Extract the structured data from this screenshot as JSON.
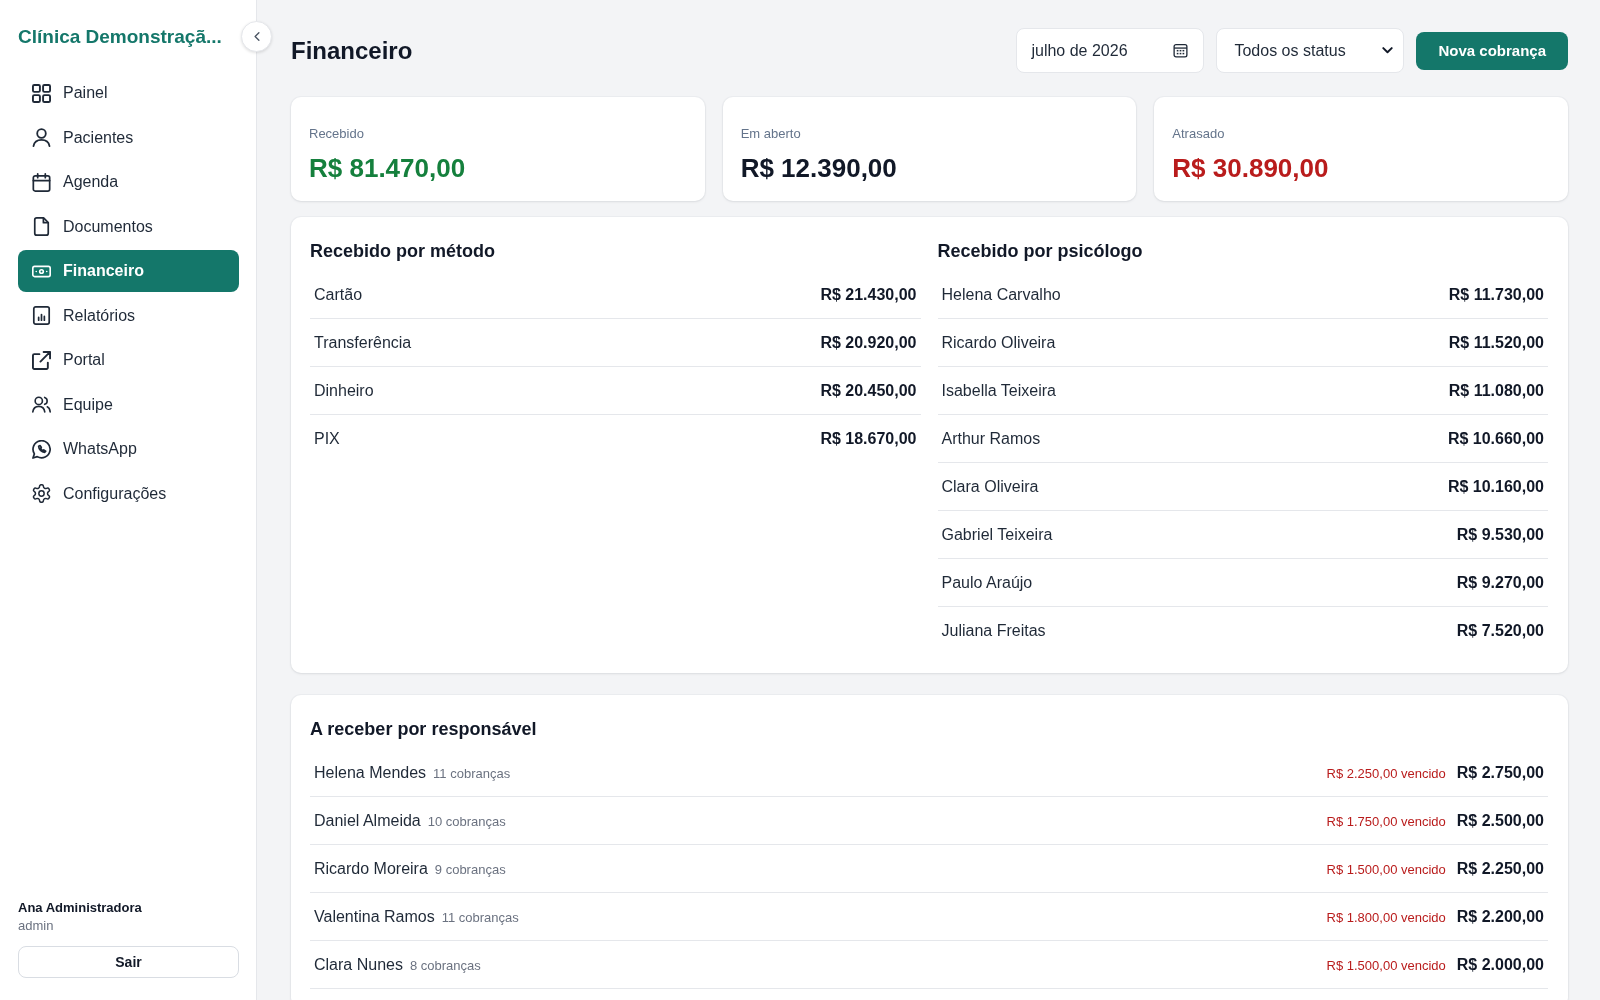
{
  "sidebar": {
    "title": "Clínica Demonstraçã...",
    "items": [
      {
        "label": "Painel",
        "selected": false
      },
      {
        "label": "Pacientes",
        "selected": false
      },
      {
        "label": "Agenda",
        "selected": false
      },
      {
        "label": "Documentos",
        "selected": false
      },
      {
        "label": "Financeiro",
        "selected": true
      },
      {
        "label": "Relatórios",
        "selected": false
      },
      {
        "label": "Portal",
        "selected": false
      },
      {
        "label": "Equipe",
        "selected": false
      },
      {
        "label": "WhatsApp",
        "selected": false
      },
      {
        "label": "Configurações",
        "selected": false
      }
    ],
    "user": {
      "name": "Ana Administradora",
      "role": "admin"
    },
    "logout_button": "Sair"
  },
  "header": {
    "title": "Financeiro",
    "month_field": {
      "value": "julho de 2026"
    },
    "status_select": {
      "value": "Todos os status"
    },
    "new_button": "Nova cobrança"
  },
  "summary_cards": [
    {
      "label": "Recebido",
      "value": "R$ 81.470,00",
      "color": "#15803d"
    },
    {
      "label": "Em aberto",
      "value": "R$ 12.390,00",
      "color": "#111827"
    },
    {
      "label": "Atrasado",
      "value": "R$ 30.890,00",
      "color": "#b91c1c"
    }
  ],
  "breakdowns": [
    {
      "title": "Recebido por método",
      "rows": [
        {
          "label": "Cartão",
          "amount": "R$ 21.430,00"
        },
        {
          "label": "Transferência",
          "amount": "R$ 20.920,00"
        },
        {
          "label": "Dinheiro",
          "amount": "R$ 20.450,00"
        },
        {
          "label": "PIX",
          "amount": "R$ 18.670,00"
        }
      ]
    },
    {
      "title": "Recebido por psicólogo",
      "rows": [
        {
          "label": "Helena Carvalho",
          "amount": "R$ 11.730,00"
        },
        {
          "label": "Ricardo Oliveira",
          "amount": "R$ 11.520,00"
        },
        {
          "label": "Isabella Teixeira",
          "amount": "R$ 11.080,00"
        },
        {
          "label": "Arthur Ramos",
          "amount": "R$ 10.660,00"
        },
        {
          "label": "Clara Oliveira",
          "amount": "R$ 10.160,00"
        },
        {
          "label": "Gabriel Teixeira",
          "amount": "R$ 9.530,00"
        },
        {
          "label": "Paulo Araújo",
          "amount": "R$ 9.270,00"
        },
        {
          "label": "Juliana Freitas",
          "amount": "R$ 7.520,00"
        }
      ]
    }
  ],
  "receivables": {
    "title": "A receber por responsável",
    "rows": [
      {
        "name": "Helena Mendes",
        "count": "11 cobranças",
        "overdue": "R$ 2.250,00 vencido",
        "amount": "R$ 2.750,00"
      },
      {
        "name": "Daniel Almeida",
        "count": "10 cobranças",
        "overdue": "R$ 1.750,00 vencido",
        "amount": "R$ 2.500,00"
      },
      {
        "name": "Ricardo Moreira",
        "count": "9 cobranças",
        "overdue": "R$ 1.500,00 vencido",
        "amount": "R$ 2.250,00"
      },
      {
        "name": "Valentina Ramos",
        "count": "11 cobranças",
        "overdue": "R$ 1.800,00 vencido",
        "amount": "R$ 2.200,00"
      },
      {
        "name": "Clara Nunes",
        "count": "8 cobranças",
        "overdue": "R$ 1.500,00 vencido",
        "amount": "R$ 2.000,00"
      }
    ]
  }
}
